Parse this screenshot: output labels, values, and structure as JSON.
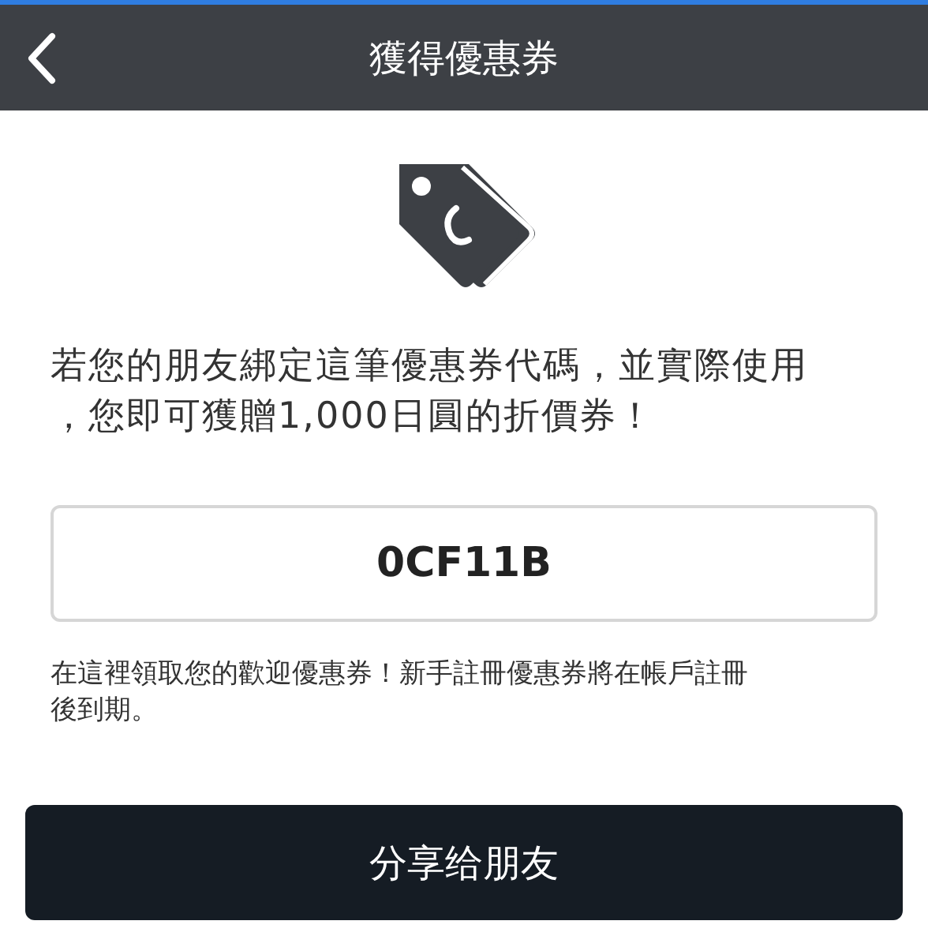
{
  "header": {
    "title": "獲得優惠券"
  },
  "message": "若您的朋友綁定這筆優惠券代碼，並實際使用，您即可獲贈1,000日圓的折價券！",
  "coupon_code": {
    "value": "0CF11B"
  },
  "note": "在這裡領取您的歡迎優惠券！新手註冊優惠券將在帳戶註冊後到期。",
  "share_button": {
    "label": "分享给朋友"
  }
}
